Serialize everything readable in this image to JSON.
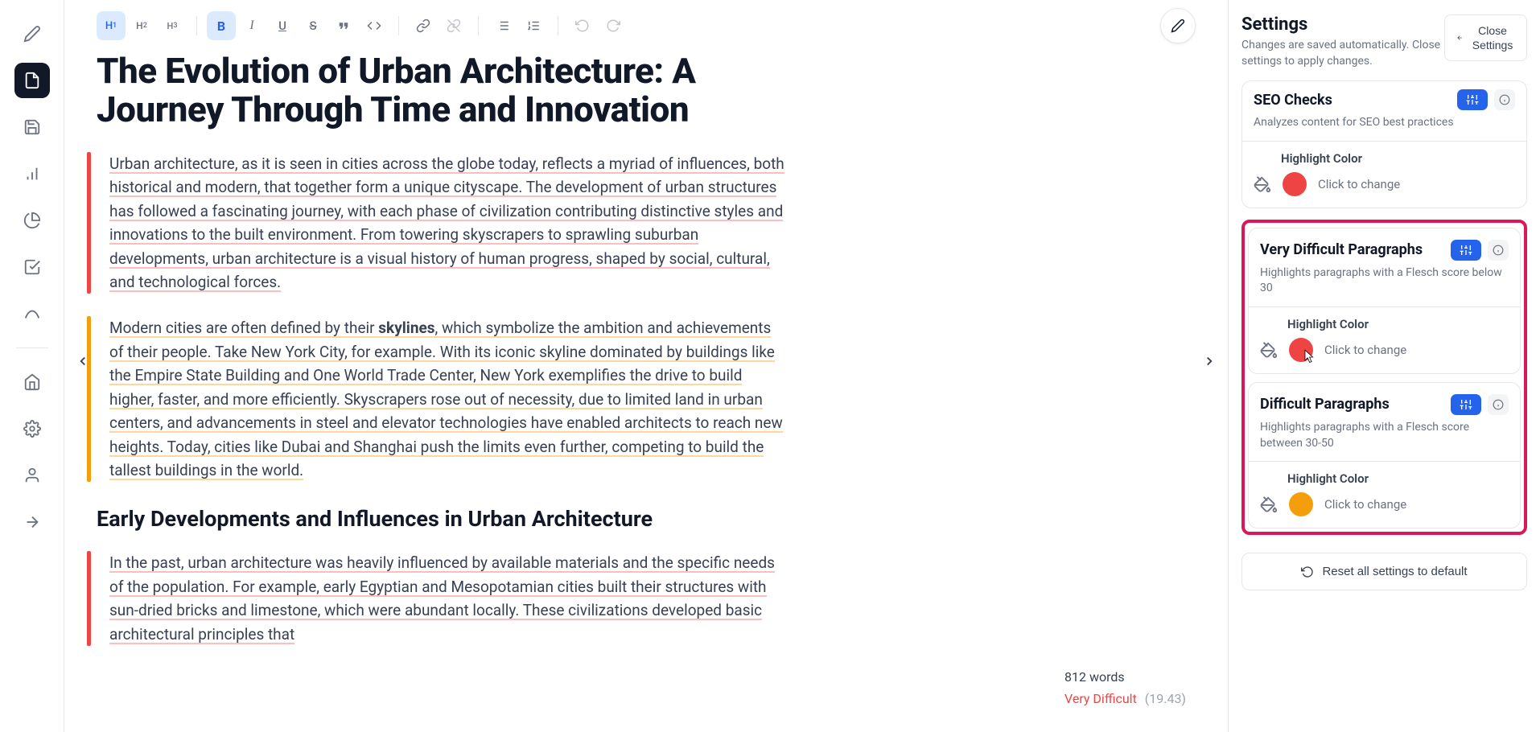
{
  "toolbar": {
    "h1": "H",
    "h1sub": "1",
    "h2": "H",
    "h2sub": "2",
    "h3": "H",
    "h3sub": "3"
  },
  "document": {
    "title": "The Evolution of Urban Architecture: A Journey Through Time and Innovation",
    "para1": "Urban architecture, as it is seen in cities across the globe today, reflects a myriad of influences, both historical and modern, that together form a unique cityscape. The development of urban structures has followed a fascinating journey, with each phase of civilization contributing distinctive styles and innovations to the built environment. From towering skyscrapers to sprawling suburban developments, urban architecture is a visual history of human progress, shaped by social, cultural, and technological forces.",
    "para2a": "Modern cities are often defined by their ",
    "para2bold": "skylines",
    "para2b": ", which symbolize the ambition and achievements of their people. Take New York City, for example. With its iconic skyline dominated by buildings like the Empire State Building and One World Trade Center, New York exemplifies the drive to build higher, faster, and more efficiently. Skyscrapers rose out of necessity, due to limited land in urban centers, and advancements in steel and elevator technologies have enabled architects to reach new heights. Today, cities like Dubai and Shanghai push the limits even further, competing to build the tallest buildings in the world.",
    "subheading": "Early Developments and Influences in Urban Architecture",
    "para3": "In the past, urban architecture was heavily influenced by available materials and the specific needs of the population. For example, early Egyptian and Mesopotamian cities built their structures with sun-dried bricks and limestone, which were abundant locally. These civilizations developed basic architectural principles that"
  },
  "stats": {
    "words": "812 words",
    "difficulty_label": "Very Difficult",
    "difficulty_score": "(19.43)"
  },
  "settings": {
    "title": "Settings",
    "subtitle": "Changes are saved automatically. Close settings to apply changes.",
    "close_btn": "Close Settings",
    "seo": {
      "title": "SEO Checks",
      "desc": "Analyzes content for SEO best practices",
      "hc_label": "Highlight Color",
      "hc_action": "Click to change"
    },
    "vd": {
      "title": "Very Difficult Paragraphs",
      "desc": "Highlights paragraphs with a Flesch score below 30",
      "hc_label": "Highlight Color",
      "hc_action": "Click to change"
    },
    "dp": {
      "title": "Difficult Paragraphs",
      "desc": "Highlights paragraphs with a Flesch score between 30-50",
      "hc_label": "Highlight Color",
      "hc_action": "Click to change"
    },
    "reset": "Reset all settings to default"
  }
}
